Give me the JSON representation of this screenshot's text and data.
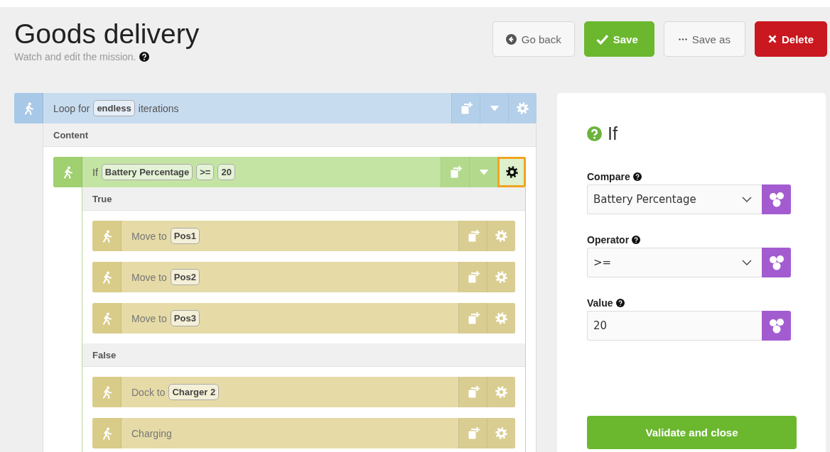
{
  "header": {
    "title": "Goods delivery",
    "subtitle": "Watch and edit the mission.",
    "buttons": [
      {
        "kind": "back",
        "label": "Go back"
      },
      {
        "kind": "save",
        "label": "Save"
      },
      {
        "kind": "saveas",
        "label": "Save as"
      },
      {
        "kind": "delete",
        "label": "Delete"
      }
    ]
  },
  "mission": {
    "kind": "loop",
    "selected": false,
    "parts": [
      {
        "kind": "text",
        "text": "Loop for"
      },
      {
        "kind": "param",
        "text": "endless"
      },
      {
        "kind": "text",
        "text": "iterations"
      }
    ],
    "sections": [
      {
        "title": "Content",
        "blocks": [
          {
            "kind": "if",
            "selected": true,
            "parts": [
              {
                "kind": "text",
                "text": "If"
              },
              {
                "kind": "param",
                "text": "Battery Percentage"
              },
              {
                "kind": "param",
                "text": ">="
              },
              {
                "kind": "param",
                "text": "20"
              }
            ],
            "sections": [
              {
                "title": "True",
                "blocks": [
                  {
                    "kind": "action",
                    "selected": false,
                    "parts": [
                      {
                        "kind": "text",
                        "text": "Move to"
                      },
                      {
                        "kind": "param",
                        "text": "Pos1"
                      }
                    ]
                  },
                  {
                    "kind": "action",
                    "selected": false,
                    "parts": [
                      {
                        "kind": "text",
                        "text": "Move to"
                      },
                      {
                        "kind": "param",
                        "text": "Pos2"
                      }
                    ]
                  },
                  {
                    "kind": "action",
                    "selected": false,
                    "parts": [
                      {
                        "kind": "text",
                        "text": "Move to"
                      },
                      {
                        "kind": "param",
                        "text": "Pos3"
                      }
                    ]
                  }
                ]
              },
              {
                "title": "False",
                "blocks": [
                  {
                    "kind": "action",
                    "selected": false,
                    "parts": [
                      {
                        "kind": "text",
                        "text": "Dock to"
                      },
                      {
                        "kind": "param",
                        "text": "Charger 2"
                      }
                    ]
                  },
                  {
                    "kind": "action",
                    "selected": false,
                    "parts": [
                      {
                        "kind": "text",
                        "text": "Charging"
                      }
                    ]
                  }
                ]
              }
            ]
          }
        ]
      }
    ]
  },
  "editor": {
    "title": "If",
    "fields": [
      {
        "kind": "select",
        "label": "Compare",
        "value": "Battery Percentage"
      },
      {
        "kind": "select",
        "label": "Operator",
        "value": ">="
      },
      {
        "kind": "input",
        "label": "Value",
        "value": "20"
      }
    ],
    "confirm": "Validate and close"
  }
}
